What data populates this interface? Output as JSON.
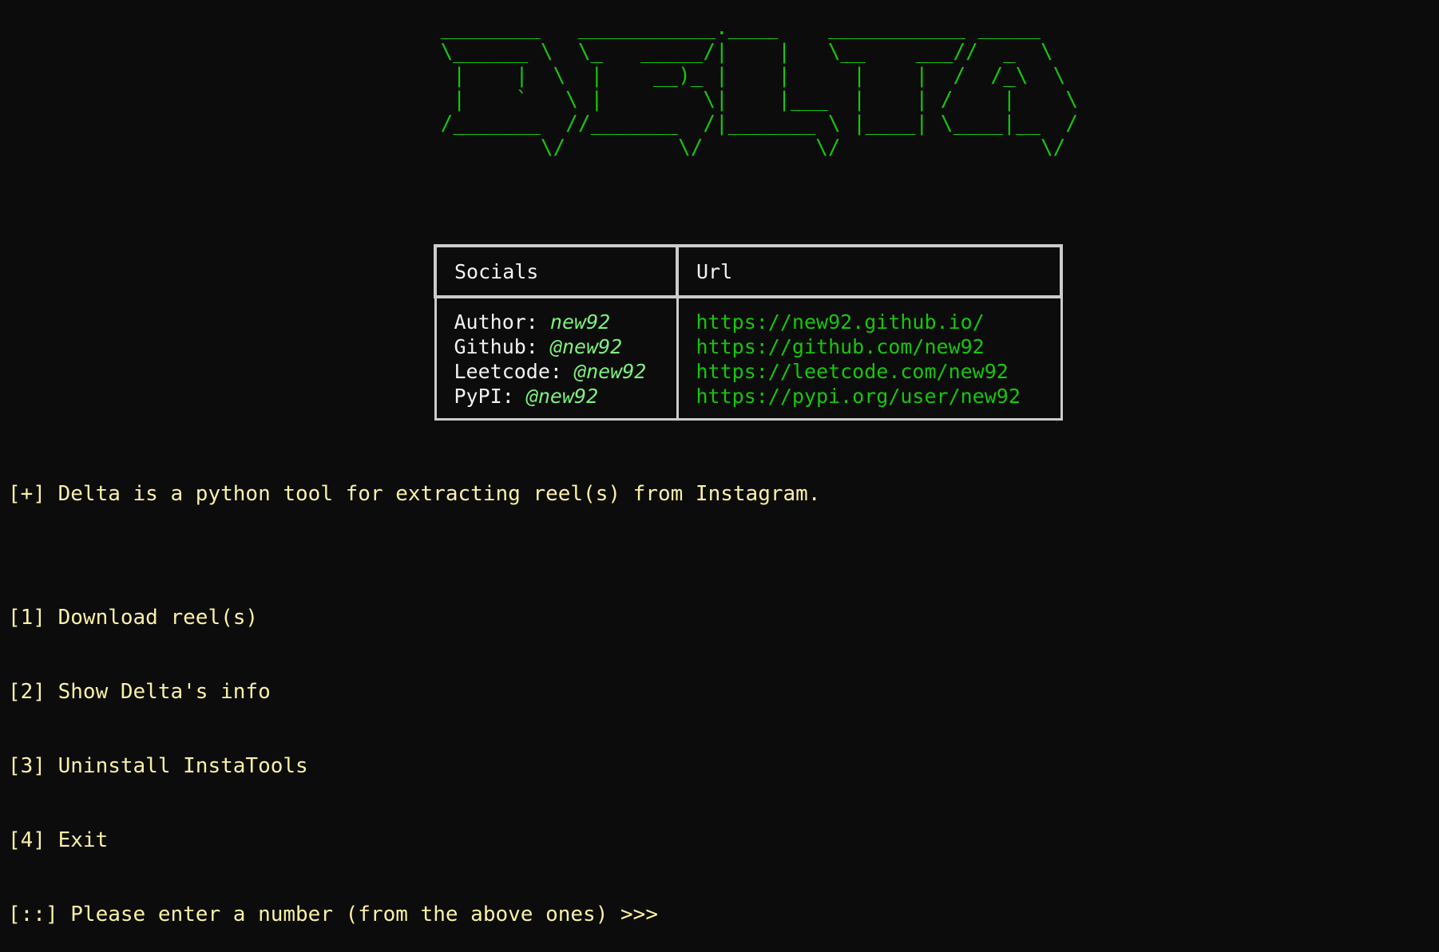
{
  "banner": {
    "ascii_art": " ________   ___________.____    ___________ _____   \n \\______ \\  \\_   _____/|    |   \\__    ___//  _  \\  \n  |    |  \\  |    __)_ |    |     |    |  /  /_\\  \\ \n  |    `   \\ |        \\|    |___  |    | /    |    \\\n /_______  //_______  /|_______ \\ |____| \\____|__  /\n         \\/         \\/         \\/                \\/ "
  },
  "socials_table": {
    "headers": [
      "Socials",
      "Url"
    ],
    "rows": [
      {
        "label": "Author: ",
        "handle": "new92",
        "url": "https://new92.github.io/"
      },
      {
        "label": "Github: ",
        "handle": "@new92",
        "url": "https://github.com/new92"
      },
      {
        "label": "Leetcode: ",
        "handle": "@new92",
        "url": "https://leetcode.com/new92"
      },
      {
        "label": "PyPI: ",
        "handle": "@new92",
        "url": "https://pypi.org/user/new92"
      }
    ]
  },
  "description": "[+] Delta is a python tool for extracting reel(s) from Instagram.",
  "menu": {
    "options": [
      "[1] Download reel(s)",
      "[2] Show Delta's info",
      "[3] Uninstall InstaTools",
      "[4] Exit"
    ],
    "prompt": "[::] Please enter a number (from the above ones) >>>"
  },
  "colors": {
    "background": "#0c0c0c",
    "banner_green": "#16c60c",
    "handle_green": "#7ef07e",
    "text_yellow": "#f9f1a5",
    "table_border": "#cccccc"
  }
}
